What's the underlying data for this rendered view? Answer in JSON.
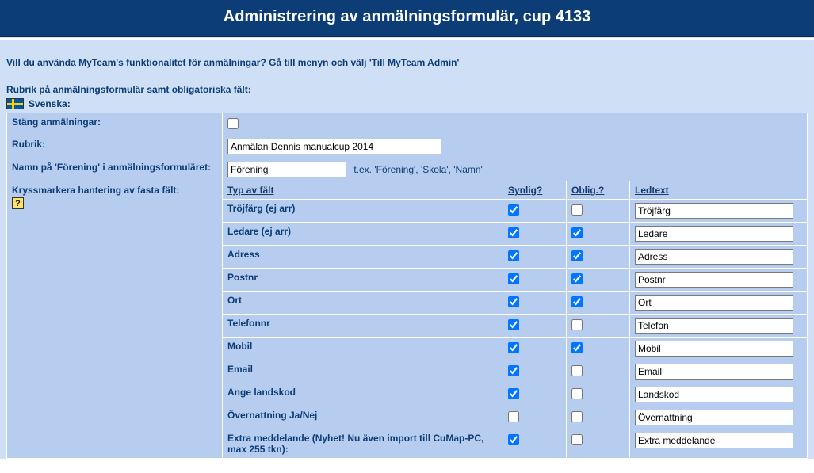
{
  "title": "Administrering av anmälningsformulär, cup 4133",
  "intro": "Vill du använda MyTeam's funktionalitet för anmälningar? Gå till menyn och välj 'Till MyTeam Admin'",
  "section_head": "Rubrik på anmälningsformulär samt obligatoriska fält:",
  "lang_label": "Svenska:",
  "labels": {
    "close_reg": "Stäng anmälningar:",
    "rubrik": "Rubrik:",
    "assoc_name": "Namn på 'Förening' i anmälningsformuläret:",
    "assoc_hint": "t.ex. 'Förening', 'Skola', 'Namn'",
    "fixed_fields": "Kryssmarkera hantering av fasta fält:"
  },
  "inputs": {
    "rubrik_value": "Anmälan Dennis manualcup 2014",
    "assoc_value": "Förening"
  },
  "headers": {
    "type": "Typ av fält",
    "visible": "Synlig?",
    "oblig": "Oblig.?",
    "ledtext": "Ledtext"
  },
  "rows": [
    {
      "type": "Tröjfärg (ej arr)",
      "visible": true,
      "oblig": false,
      "led": "Tröjfärg"
    },
    {
      "type": "Ledare (ej arr)",
      "visible": true,
      "oblig": true,
      "led": "Ledare"
    },
    {
      "type": "Adress",
      "visible": true,
      "oblig": true,
      "led": "Adress"
    },
    {
      "type": "Postnr",
      "visible": true,
      "oblig": true,
      "led": "Postnr"
    },
    {
      "type": "Ort",
      "visible": true,
      "oblig": true,
      "led": "Ort"
    },
    {
      "type": "Telefonnr",
      "visible": true,
      "oblig": false,
      "led": "Telefon"
    },
    {
      "type": "Mobil",
      "visible": true,
      "oblig": true,
      "led": "Mobil"
    },
    {
      "type": "Email",
      "visible": true,
      "oblig": false,
      "led": "Email"
    },
    {
      "type": "Ange landskod",
      "visible": true,
      "oblig": false,
      "led": "Landskod"
    },
    {
      "type": "Övernattning Ja/Nej",
      "visible": false,
      "oblig": false,
      "led": "Övernattning"
    },
    {
      "type": "Extra meddelande (Nyhet! Nu även import till CuMap-PC, max 255 tkn):",
      "visible": true,
      "oblig": false,
      "led": "Extra meddelande"
    }
  ],
  "help_q": "?"
}
